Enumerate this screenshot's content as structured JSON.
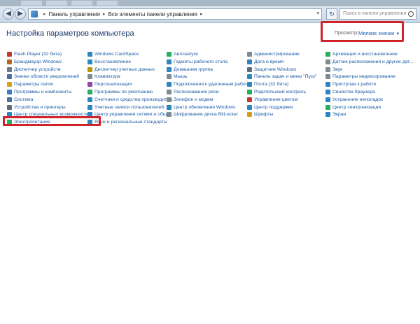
{
  "navbar": {
    "address_parts": [
      "Панель управления",
      "Все элементы панели управления"
    ],
    "search_placeholder": "Поиск в панели управления"
  },
  "header": {
    "title": "Настройка параметров компьютера",
    "view_label": "Просмотр:",
    "view_value": "Мелкие значки"
  },
  "colors": {
    "link": "#1b5aa6",
    "highlight_border": "#d2232a"
  },
  "columns": [
    {
      "items": [
        {
          "label": "Flash Player (32 бита)",
          "color": "#c0392b"
        },
        {
          "label": "Брандмауэр Windows",
          "color": "#b5651d"
        },
        {
          "label": "Диспетчер устройств",
          "color": "#6b7b8c"
        },
        {
          "label": "Значки области уведомлений",
          "color": "#4a6fa5"
        },
        {
          "label": "Параметры папок",
          "color": "#d4a017"
        },
        {
          "label": "Программы и компоненты",
          "color": "#3b7dc4"
        },
        {
          "label": "Система",
          "color": "#4a6fa5"
        },
        {
          "label": "Устройства и принтеры",
          "color": "#5d6d7e"
        },
        {
          "label": "Центр специальных возможностей",
          "color": "#2e86c1"
        },
        {
          "label": "Электропитание",
          "color": "#27ae60"
        }
      ]
    },
    {
      "items": [
        {
          "label": "Windows CardSpace",
          "color": "#2e86c1"
        },
        {
          "label": "Восстановление",
          "color": "#2e86c1"
        },
        {
          "label": "Диспетчер учетных данных",
          "color": "#b7950b"
        },
        {
          "label": "Клавиатура",
          "color": "#7f8c8d"
        },
        {
          "label": "Персонализация",
          "color": "#8e44ad"
        },
        {
          "label": "Программы по умолчанию",
          "color": "#27ae60"
        },
        {
          "label": "Счетчики и средства производител...",
          "color": "#2e86c1"
        },
        {
          "label": "Учетные записи пользователей",
          "color": "#2e86c1"
        },
        {
          "label": "Центр управления сетями и общи...",
          "color": "#2e86c1"
        },
        {
          "label": "Язык и региональные стандарты",
          "color": "#2e86c1"
        }
      ]
    },
    {
      "items": [
        {
          "label": "Автозапуск",
          "color": "#27ae60"
        },
        {
          "label": "Гаджеты рабочего стола",
          "color": "#2e86c1"
        },
        {
          "label": "Домашняя группа",
          "color": "#2e86c1"
        },
        {
          "label": "Мышь",
          "color": "#7f8c8d"
        },
        {
          "label": "Подключения к удаленным рабоч...",
          "color": "#2e86c1"
        },
        {
          "label": "Распознавание речи",
          "color": "#7f8c8d"
        },
        {
          "label": "Телефон и модем",
          "color": "#7f8c8d"
        },
        {
          "label": "Центр обновления Windows",
          "color": "#2e86c1"
        },
        {
          "label": "Шифрование диска BitLocker",
          "color": "#7f8c8d"
        }
      ]
    },
    {
      "items": [
        {
          "label": "Администрирование",
          "color": "#7f8c8d"
        },
        {
          "label": "Дата и время",
          "color": "#2e86c1"
        },
        {
          "label": "Защитник Windows",
          "color": "#5d6d7e"
        },
        {
          "label": "Панель задач и меню \"Пуск\"",
          "color": "#2e86c1"
        },
        {
          "label": "Почта (32 бита)",
          "color": "#2e86c1"
        },
        {
          "label": "Родительский контроль",
          "color": "#27ae60"
        },
        {
          "label": "Управление цветом",
          "color": "#c0392b"
        },
        {
          "label": "Центр поддержки",
          "color": "#2e86c1"
        },
        {
          "label": "Шрифты",
          "color": "#d4a017"
        }
      ]
    },
    {
      "items": [
        {
          "label": "Архивация и восстановление",
          "color": "#27ae60"
        },
        {
          "label": "Датчик расположения и другие дат...",
          "color": "#7f8c8d"
        },
        {
          "label": "Звук",
          "color": "#7f8c8d"
        },
        {
          "label": "Параметры индексирования",
          "color": "#7f8c8d"
        },
        {
          "label": "Приступая к работе",
          "color": "#2e86c1"
        },
        {
          "label": "Свойства браузера",
          "color": "#2e86c1"
        },
        {
          "label": "Устранение неполадок",
          "color": "#2e86c1"
        },
        {
          "label": "Центр синхронизации",
          "color": "#27ae60"
        },
        {
          "label": "Экран",
          "color": "#2e86c1"
        }
      ]
    }
  ]
}
